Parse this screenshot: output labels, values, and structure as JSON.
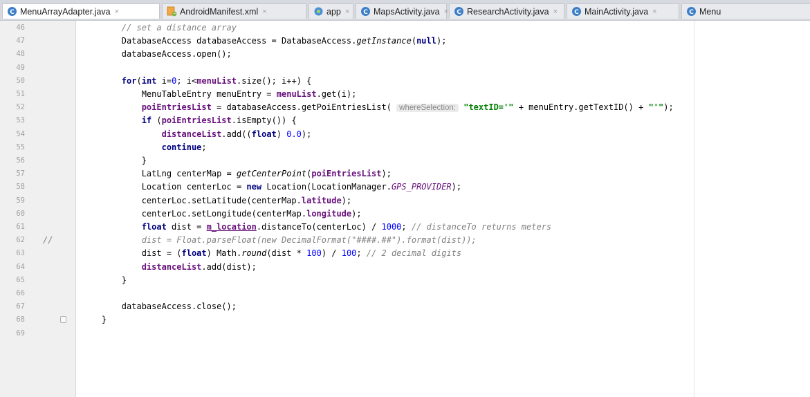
{
  "tabs": [
    {
      "label": "MenuArrayAdapter.java",
      "icon": "java-class-icon",
      "active": true
    },
    {
      "label": "AndroidManifest.xml",
      "icon": "xml-manifest-icon"
    },
    {
      "label": "app",
      "icon": "module-icon"
    },
    {
      "label": "MapsActivity.java",
      "icon": "java-class-icon"
    },
    {
      "label": "ResearchActivity.java",
      "icon": "java-class-icon"
    },
    {
      "label": "MainActivity.java",
      "icon": "java-class-icon"
    },
    {
      "label": "Menu",
      "icon": "java-class-icon"
    }
  ],
  "close_glyph": "×",
  "gutter": {
    "comment_marker": "//"
  },
  "lines": [
    {
      "num": "46",
      "tokens": [
        {
          "t": "        // set a distance array",
          "c": "cmt"
        }
      ]
    },
    {
      "num": "47",
      "tokens": [
        {
          "t": "        DatabaseAccess databaseAccess = DatabaseAccess."
        },
        {
          "t": "getInstance",
          "c": "ital"
        },
        {
          "t": "("
        },
        {
          "t": "null",
          "c": "kw"
        },
        {
          "t": ");"
        }
      ]
    },
    {
      "num": "48",
      "tokens": [
        {
          "t": "        databaseAccess.open();"
        }
      ]
    },
    {
      "num": "49",
      "tokens": []
    },
    {
      "num": "50",
      "tokens": [
        {
          "t": "        "
        },
        {
          "t": "for",
          "c": "kw"
        },
        {
          "t": "("
        },
        {
          "t": "int",
          "c": "kw"
        },
        {
          "t": " i="
        },
        {
          "t": "0",
          "c": "num"
        },
        {
          "t": "; i<"
        },
        {
          "t": "menuList",
          "c": "fld"
        },
        {
          "t": ".size(); i++) {"
        }
      ]
    },
    {
      "num": "51",
      "tokens": [
        {
          "t": "            MenuTableEntry menuEntry = "
        },
        {
          "t": "menuList",
          "c": "fld"
        },
        {
          "t": ".get(i);"
        }
      ]
    },
    {
      "num": "52",
      "tokens": [
        {
          "t": "            "
        },
        {
          "t": "poiEntriesList",
          "c": "fld"
        },
        {
          "t": " = databaseAccess.getPoiEntriesList( "
        },
        {
          "t": "whereSelection:",
          "c": "hint"
        },
        {
          "t": " "
        },
        {
          "t": "\"textID='\"",
          "c": "str"
        },
        {
          "t": " + menuEntry.getTextID() + "
        },
        {
          "t": "\"'\"",
          "c": "str"
        },
        {
          "t": ");"
        }
      ]
    },
    {
      "num": "53",
      "tokens": [
        {
          "t": "            "
        },
        {
          "t": "if",
          "c": "kw"
        },
        {
          "t": " ("
        },
        {
          "t": "poiEntriesList",
          "c": "fld"
        },
        {
          "t": ".isEmpty()) {"
        }
      ]
    },
    {
      "num": "54",
      "tokens": [
        {
          "t": "                "
        },
        {
          "t": "distanceList",
          "c": "fld"
        },
        {
          "t": ".add(("
        },
        {
          "t": "float",
          "c": "kw"
        },
        {
          "t": ") "
        },
        {
          "t": "0.0",
          "c": "num"
        },
        {
          "t": ");"
        }
      ]
    },
    {
      "num": "55",
      "tokens": [
        {
          "t": "                "
        },
        {
          "t": "continue",
          "c": "kw"
        },
        {
          "t": ";"
        }
      ]
    },
    {
      "num": "56",
      "tokens": [
        {
          "t": "            }"
        }
      ]
    },
    {
      "num": "57",
      "tokens": [
        {
          "t": "            LatLng centerMap = "
        },
        {
          "t": "getCenterPoint",
          "c": "ital"
        },
        {
          "t": "("
        },
        {
          "t": "poiEntriesList",
          "c": "fld"
        },
        {
          "t": ");"
        }
      ]
    },
    {
      "num": "58",
      "tokens": [
        {
          "t": "            Location centerLoc = "
        },
        {
          "t": "new",
          "c": "kw"
        },
        {
          "t": " Location(LocationManager."
        },
        {
          "t": "GPS_PROVIDER",
          "c": "sfld"
        },
        {
          "t": ");"
        }
      ]
    },
    {
      "num": "59",
      "tokens": [
        {
          "t": "            centerLoc.setLatitude(centerMap."
        },
        {
          "t": "latitude",
          "c": "fld"
        },
        {
          "t": ");"
        }
      ]
    },
    {
      "num": "60",
      "tokens": [
        {
          "t": "            centerLoc.setLongitude(centerMap."
        },
        {
          "t": "longitude",
          "c": "fld"
        },
        {
          "t": ");"
        }
      ]
    },
    {
      "num": "61",
      "tokens": [
        {
          "t": "            "
        },
        {
          "t": "float",
          "c": "kw"
        },
        {
          "t": " dist = "
        },
        {
          "t": "m_location",
          "c": "fld u"
        },
        {
          "t": ".distanceTo(centerLoc) / "
        },
        {
          "t": "1000",
          "c": "num"
        },
        {
          "t": "; "
        },
        {
          "t": "// distanceTo returns meters",
          "c": "cmt"
        }
      ]
    },
    {
      "num": "62",
      "gutter_comment": true,
      "tokens": [
        {
          "t": "            dist = Float.parseFloat(new DecimalFormat(\"####.##\").format(dist));",
          "c": "cmt"
        }
      ]
    },
    {
      "num": "63",
      "tokens": [
        {
          "t": "            dist = ("
        },
        {
          "t": "float",
          "c": "kw"
        },
        {
          "t": ") Math."
        },
        {
          "t": "round",
          "c": "ital"
        },
        {
          "t": "(dist * "
        },
        {
          "t": "100",
          "c": "num"
        },
        {
          "t": ") / "
        },
        {
          "t": "100",
          "c": "num"
        },
        {
          "t": "; "
        },
        {
          "t": "// 2 decimal digits",
          "c": "cmt"
        }
      ]
    },
    {
      "num": "64",
      "tokens": [
        {
          "t": "            "
        },
        {
          "t": "distanceList",
          "c": "fld"
        },
        {
          "t": ".add(dist);"
        }
      ]
    },
    {
      "num": "65",
      "tokens": [
        {
          "t": "        }"
        }
      ]
    },
    {
      "num": "66",
      "tokens": []
    },
    {
      "num": "67",
      "tokens": [
        {
          "t": "        databaseAccess.close();"
        }
      ]
    },
    {
      "num": "68",
      "fold": true,
      "tokens": [
        {
          "t": "    }"
        }
      ]
    },
    {
      "num": "69",
      "tokens": []
    }
  ],
  "colors": {
    "keyword": "#000080",
    "string": "#008000",
    "comment": "#808080",
    "field": "#660e7a",
    "number": "#0000ff",
    "gutter_bg": "#f0f0f0",
    "tabbar_bg": "#d6d9df"
  }
}
